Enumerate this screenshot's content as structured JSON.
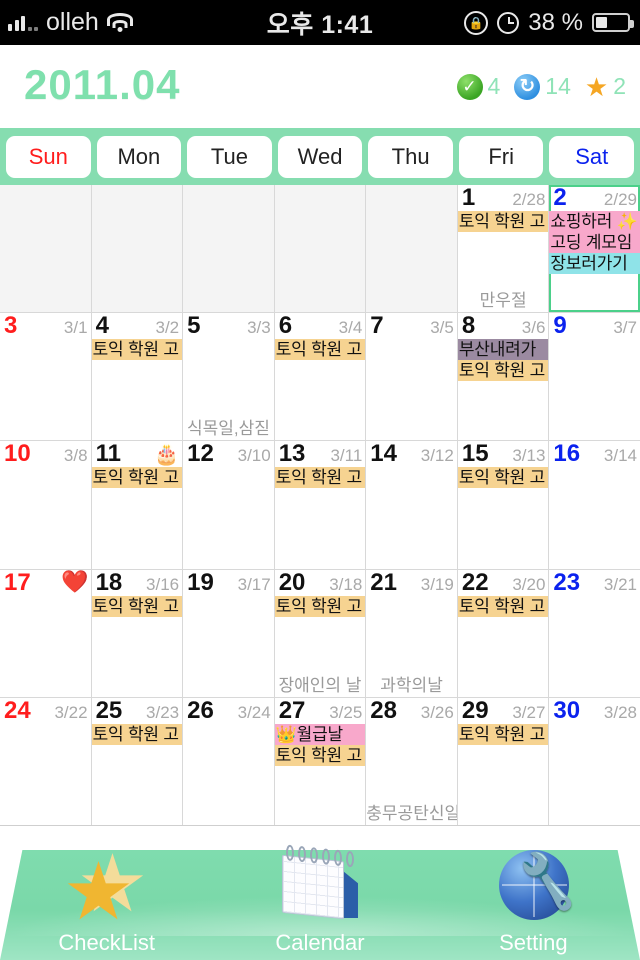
{
  "statusbar": {
    "carrier": "olleh",
    "time": "오후 1:41",
    "battery_percent": "38 %",
    "signal_icon": "signal-bars-icon",
    "wifi_icon": "wifi-icon",
    "rotation_lock_icon": "rotation-lock-icon",
    "alarm_icon": "alarm-clock-icon",
    "battery_icon": "battery-icon"
  },
  "header": {
    "month_title": "2011.04",
    "counters": [
      {
        "icon": "check-circle-icon",
        "value": "4"
      },
      {
        "icon": "repeat-circle-icon",
        "value": "14"
      },
      {
        "icon": "star-icon",
        "value": "2"
      }
    ],
    "accent_color": "#7fe0ad",
    "counter_text_color": "#8fe3b7"
  },
  "weekdays": [
    {
      "label": "Sun",
      "kind": "sun"
    },
    {
      "label": "Mon",
      "kind": "day"
    },
    {
      "label": "Tue",
      "kind": "day"
    },
    {
      "label": "Wed",
      "kind": "day"
    },
    {
      "label": "Thu",
      "kind": "day"
    },
    {
      "label": "Fri",
      "kind": "day"
    },
    {
      "label": "Sat",
      "kind": "sat"
    }
  ],
  "colors": {
    "mint": "#86ddb0",
    "event_orange": "#f6d391",
    "event_pink": "#f8a8cb",
    "event_cyan": "#8fe3e8",
    "event_purple": "#9b8aa1",
    "sunday_red": "#ff1d1d",
    "saturday_blue": "#0b22ee",
    "lunar_grey": "#a9a9a9"
  },
  "calendar": {
    "weeks": [
      [
        {
          "blank": true
        },
        {
          "blank": true
        },
        {
          "blank": true
        },
        {
          "blank": true
        },
        {
          "blank": true
        },
        {
          "day": "1",
          "lunar": "2/28",
          "kind": "day",
          "events": [
            {
              "text": "토익 학원 고",
              "color": "orange"
            }
          ],
          "holiday": "만우절"
        },
        {
          "day": "2",
          "lunar": "2/29",
          "kind": "sat",
          "selected": true,
          "events": [
            {
              "text": "쇼핑하러 ✨",
              "color": "pink"
            },
            {
              "text": "고딩 계모임",
              "color": "pink"
            },
            {
              "text": "장보러가기",
              "color": "cyan"
            }
          ]
        }
      ],
      [
        {
          "day": "3",
          "lunar": "3/1",
          "kind": "sun",
          "events": []
        },
        {
          "day": "4",
          "lunar": "3/2",
          "kind": "day",
          "events": [
            {
              "text": "토익 학원 고",
              "color": "orange"
            }
          ]
        },
        {
          "day": "5",
          "lunar": "3/3",
          "kind": "day",
          "events": [],
          "holiday": "식목일,삼짇"
        },
        {
          "day": "6",
          "lunar": "3/4",
          "kind": "day",
          "events": [
            {
              "text": "토익 학원 고",
              "color": "orange"
            }
          ]
        },
        {
          "day": "7",
          "lunar": "3/5",
          "kind": "day",
          "events": []
        },
        {
          "day": "8",
          "lunar": "3/6",
          "kind": "day",
          "events": [
            {
              "text": "부산내려가",
              "color": "purple"
            },
            {
              "text": "토익 학원 고",
              "color": "orange"
            }
          ]
        },
        {
          "day": "9",
          "lunar": "3/7",
          "kind": "sat",
          "events": []
        }
      ],
      [
        {
          "day": "10",
          "lunar": "3/8",
          "kind": "sun",
          "events": []
        },
        {
          "day": "11",
          "lunar": "",
          "lunar_emoji": "🎂",
          "kind": "day",
          "events": [
            {
              "text": "토익 학원 고",
              "color": "orange"
            }
          ]
        },
        {
          "day": "12",
          "lunar": "3/10",
          "kind": "day",
          "events": []
        },
        {
          "day": "13",
          "lunar": "3/11",
          "kind": "day",
          "events": [
            {
              "text": "토익 학원 고",
              "color": "orange"
            }
          ]
        },
        {
          "day": "14",
          "lunar": "3/12",
          "kind": "day",
          "events": []
        },
        {
          "day": "15",
          "lunar": "3/13",
          "kind": "day",
          "events": [
            {
              "text": "토익 학원 고",
              "color": "orange"
            }
          ]
        },
        {
          "day": "16",
          "lunar": "3/14",
          "kind": "sat",
          "events": []
        }
      ],
      [
        {
          "day": "17",
          "lunar": "",
          "corner_emoji": "❤️",
          "kind": "sun",
          "events": []
        },
        {
          "day": "18",
          "lunar": "3/16",
          "kind": "day",
          "events": [
            {
              "text": "토익 학원 고",
              "color": "orange"
            }
          ]
        },
        {
          "day": "19",
          "lunar": "3/17",
          "kind": "day",
          "events": []
        },
        {
          "day": "20",
          "lunar": "3/18",
          "kind": "day",
          "events": [
            {
              "text": "토익 학원 고",
              "color": "orange"
            }
          ],
          "holiday": "장애인의 날"
        },
        {
          "day": "21",
          "lunar": "3/19",
          "kind": "day",
          "events": [],
          "holiday": "과학의날"
        },
        {
          "day": "22",
          "lunar": "3/20",
          "kind": "day",
          "events": [
            {
              "text": "토익 학원 고",
              "color": "orange"
            }
          ]
        },
        {
          "day": "23",
          "lunar": "3/21",
          "kind": "sat",
          "events": []
        }
      ],
      [
        {
          "day": "24",
          "lunar": "3/22",
          "kind": "sun",
          "events": []
        },
        {
          "day": "25",
          "lunar": "3/23",
          "kind": "day",
          "events": [
            {
              "text": "토익 학원 고",
              "color": "orange"
            }
          ]
        },
        {
          "day": "26",
          "lunar": "3/24",
          "kind": "day",
          "events": []
        },
        {
          "day": "27",
          "lunar": "3/25",
          "kind": "day",
          "events": [
            {
              "text": "👑월급날",
              "color": "pink"
            },
            {
              "text": "토익 학원 고",
              "color": "orange"
            }
          ]
        },
        {
          "day": "28",
          "lunar": "3/26",
          "kind": "day",
          "events": [],
          "holiday": "충무공탄신일"
        },
        {
          "day": "29",
          "lunar": "3/27",
          "kind": "day",
          "events": [
            {
              "text": "토익 학원 고",
              "color": "orange"
            }
          ]
        },
        {
          "day": "30",
          "lunar": "3/28",
          "kind": "sat",
          "events": []
        }
      ]
    ]
  },
  "tabbar": {
    "items": [
      {
        "label": "CheckList",
        "icon": "star-icon"
      },
      {
        "label": "Calendar",
        "icon": "desk-calendar-icon"
      },
      {
        "label": "Setting",
        "icon": "globe-wrench-icon"
      }
    ]
  }
}
